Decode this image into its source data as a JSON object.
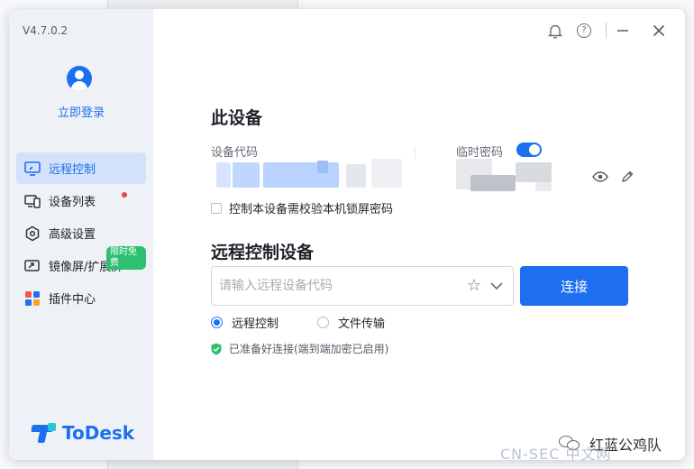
{
  "window": {
    "version": "V4.7.0.2"
  },
  "sidebar": {
    "login_label": "立即登录",
    "items": [
      {
        "label": "远程控制",
        "icon": "monitor-icon",
        "active": true
      },
      {
        "label": "设备列表",
        "icon": "devices-icon",
        "has_dot": true
      },
      {
        "label": "高级设置",
        "icon": "settings-hex-icon"
      },
      {
        "label": "镜像屏/扩展屏",
        "icon": "mirror-screen-icon",
        "badge": "限时免费"
      },
      {
        "label": "插件中心",
        "icon": "plugins-icon"
      }
    ],
    "brand": "ToDesk"
  },
  "titlebar": {
    "icons": [
      "bell-icon",
      "help-icon",
      "minimize-icon",
      "close-icon"
    ]
  },
  "this_device": {
    "title": "此设备",
    "device_code_label": "设备代码",
    "temp_password_label": "临时密码",
    "temp_password_enabled": true,
    "lock_password_checkbox_label": "控制本设备需校验本机锁屏密码",
    "lock_password_checked": false
  },
  "remote": {
    "title": "远程控制设备",
    "input_placeholder": "请输入远程设备代码",
    "input_value": "",
    "connect_label": "连接",
    "modes": [
      {
        "label": "远程控制",
        "selected": true
      },
      {
        "label": "文件传输",
        "selected": false
      }
    ],
    "status": "已准备好连接(端到端加密已启用)"
  },
  "watermark": {
    "account": "红蓝公鸡队",
    "site": "CN-SEC 中文网"
  },
  "colors": {
    "accent": "#1e6ff0",
    "sidebar_bg": "#eef1f6",
    "active_bg": "#d3e2fb",
    "badge_green": "#2fbf71",
    "status_green": "#2fbf71",
    "dot_red": "#e8473e"
  }
}
